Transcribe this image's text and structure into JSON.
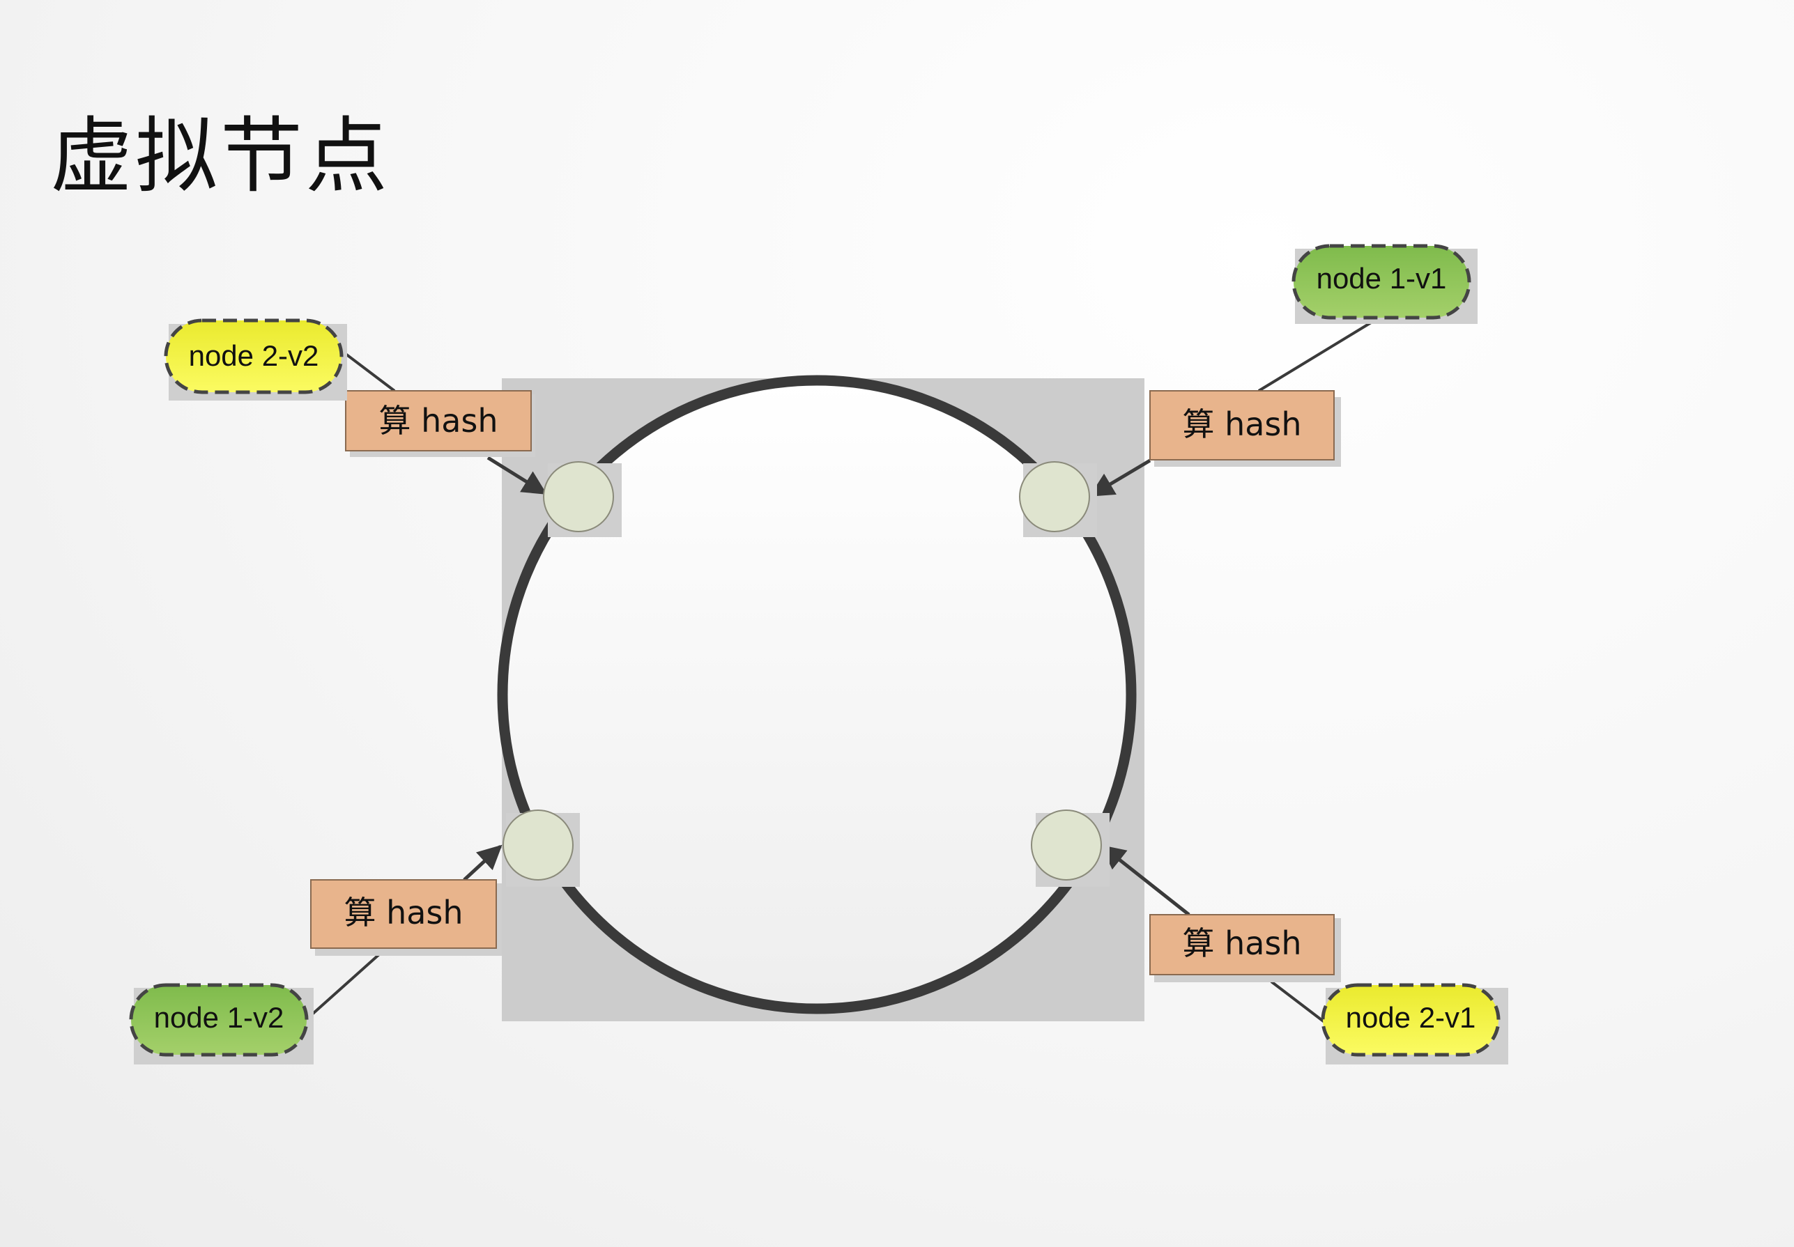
{
  "page": {
    "title": "虚拟节点"
  },
  "colors": {
    "ring": "#3a3a3a",
    "ring_bg": "#cccccc",
    "hash_box": "#e8b48c",
    "node_green": "#8fc55a",
    "node_yellow": "#f2f23a",
    "point": "#dfe4cf"
  },
  "hash_boxes": [
    {
      "id": "hash-top-left",
      "label": "算 hash"
    },
    {
      "id": "hash-top-right",
      "label": "算 hash"
    },
    {
      "id": "hash-bottom-left",
      "label": "算 hash"
    },
    {
      "id": "hash-bottom-right",
      "label": "算 hash"
    }
  ],
  "nodes": [
    {
      "id": "node-2-v2",
      "label": "node 2-v2",
      "color": "#f2f23a"
    },
    {
      "id": "node-1-v1",
      "label": "node 1-v1",
      "color": "#8fc55a"
    },
    {
      "id": "node-1-v2",
      "label": "node 1-v2",
      "color": "#8fc55a"
    },
    {
      "id": "node-2-v1",
      "label": "node 2-v1",
      "color": "#f2f23a"
    }
  ]
}
